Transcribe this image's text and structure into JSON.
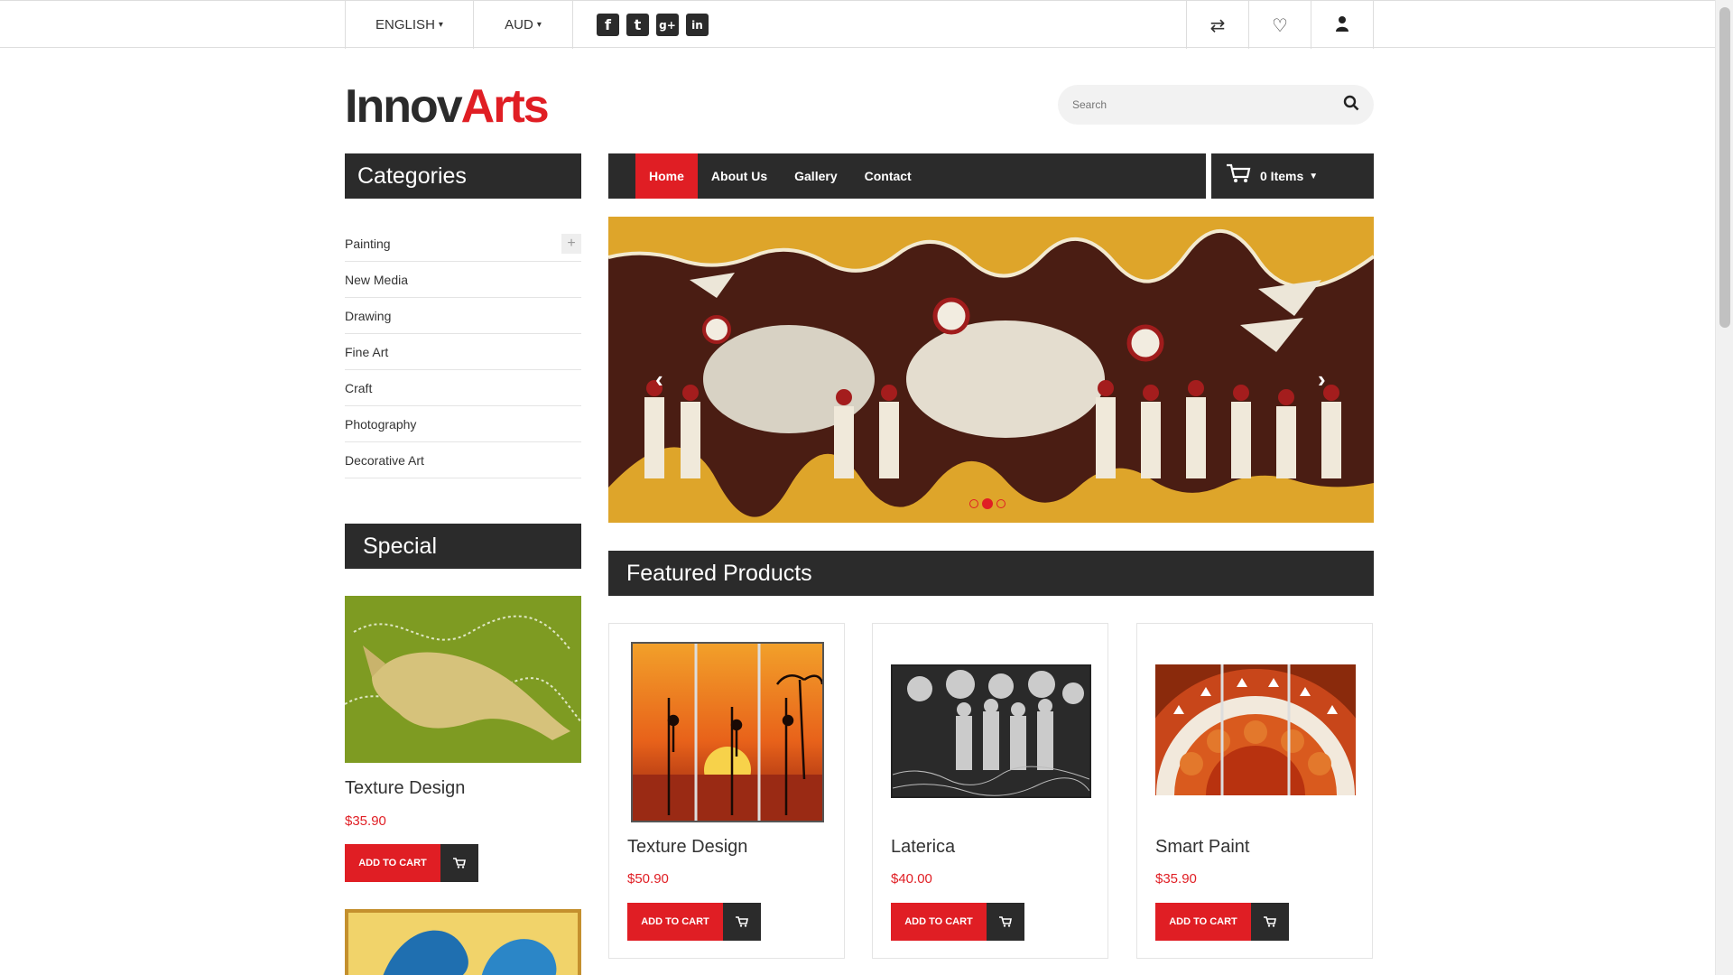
{
  "topbar": {
    "language": "ENGLISH",
    "currency": "AUD",
    "social_icons": [
      "facebook-icon",
      "twitter-icon",
      "google-plus-icon",
      "linkedin-icon"
    ],
    "social_glyphs": [
      "f",
      "t",
      "g+",
      "in"
    ],
    "compare_glyph": "⇄",
    "wishlist_glyph": "♡",
    "account_glyph": "●"
  },
  "brand": {
    "logo_part1": "Innov",
    "logo_part2": "Arts",
    "accent": "#e01e24",
    "dark": "#2b2b2b"
  },
  "search": {
    "placeholder": "Search",
    "icon_glyph": "⌕"
  },
  "sidebar": {
    "categories_title": "Categories",
    "categories": [
      "Painting",
      "New Media",
      "Drawing",
      "Fine Art",
      "Craft",
      "Photography",
      "Decorative Art"
    ],
    "expand_glyph": "+",
    "special_title": "Special",
    "special_product": {
      "title": "Texture Design",
      "price": "$35.90",
      "add_label": "ADD TO CART"
    }
  },
  "nav": {
    "items": [
      "Home",
      "About Us",
      "Gallery",
      "Contact"
    ],
    "active": "Home",
    "cart_label": "0 Items",
    "cart_glyph": "⛟",
    "caret": "▼"
  },
  "banner": {
    "prev_glyph": "‹",
    "next_glyph": "›",
    "active_dot": 2,
    "dot_count": 3
  },
  "featured": {
    "title": "Featured Products",
    "products": [
      {
        "title": "Texture Design",
        "price": "$50.90",
        "add_label": "ADD TO CART"
      },
      {
        "title": "Laterica",
        "price": "$40.00",
        "add_label": "ADD TO CART"
      },
      {
        "title": "Smart Paint",
        "price": "$35.90",
        "add_label": "ADD TO CART"
      }
    ]
  },
  "cart_button_glyph": "🛒"
}
